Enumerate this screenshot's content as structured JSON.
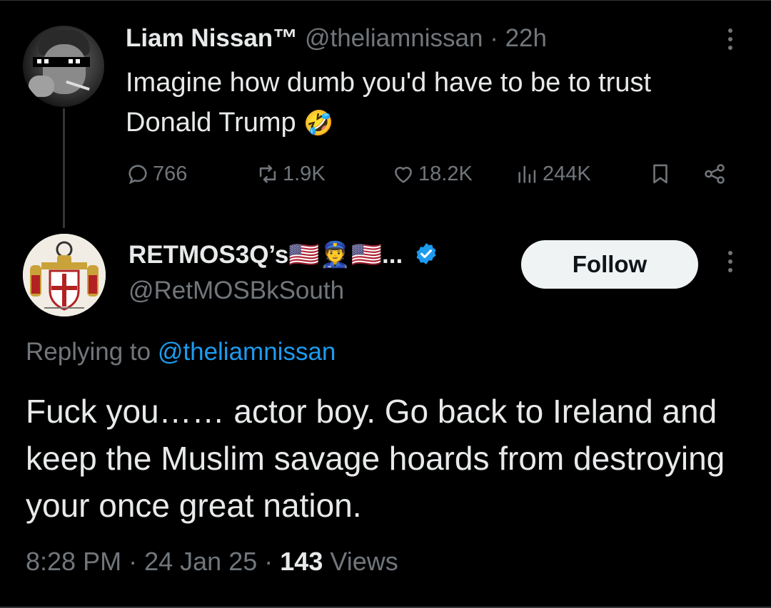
{
  "parent_tweet": {
    "name": "Liam Nissan™",
    "handle": "@theliamnissan",
    "separator": "·",
    "time": "22h",
    "text_line1": "Imagine how dumb you'd have to be to trust",
    "text_line2": "Donald Trump",
    "emoji": "🤣",
    "replies": "766",
    "retweets": "1.9K",
    "likes": "18.2K",
    "views": "244K"
  },
  "reply_tweet": {
    "name": "RETMOS3Q’s🇺🇸👮🇺🇸...",
    "handle": "@RetMOSBkSouth",
    "follow_label": "Follow",
    "replying_prefix": "Replying to",
    "replying_to": "@theliamnissan",
    "text": "Fuck you…… actor boy. Go back to Ireland and keep the Muslim savage hoards from destroying your once great nation.",
    "time": "8:28 PM",
    "date": "24 Jan 25",
    "separator": "·",
    "views_count": "143",
    "views_label": "Views"
  },
  "colors": {
    "background": "#000000",
    "text": "#e7e9ea",
    "secondary": "#71767b",
    "link": "#1d9bf0",
    "verified": "#1d9bf0",
    "follow_bg": "#eff3f4"
  }
}
